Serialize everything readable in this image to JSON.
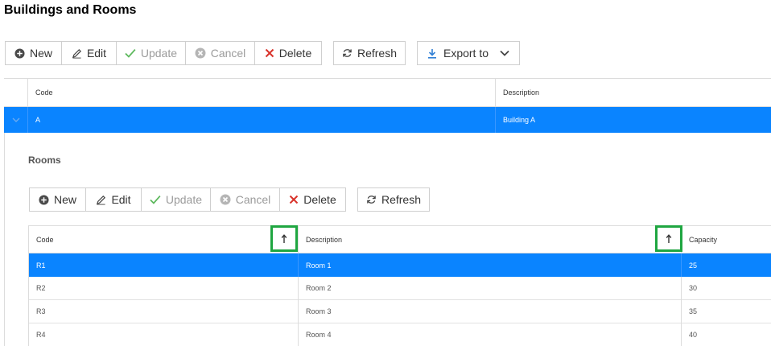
{
  "page": {
    "title": "Buildings and Rooms"
  },
  "buildings_toolbar": {
    "new": "New",
    "edit": "Edit",
    "update": "Update",
    "cancel": "Cancel",
    "delete": "Delete",
    "refresh": "Refresh",
    "export": "Export to"
  },
  "buildings_grid": {
    "columns": [
      "Code",
      "Description"
    ],
    "rows": [
      {
        "code": "A",
        "description": "Building A",
        "selected": true
      }
    ]
  },
  "rooms": {
    "title": "Rooms",
    "toolbar": {
      "new": "New",
      "edit": "Edit",
      "update": "Update",
      "cancel": "Cancel",
      "delete": "Delete",
      "refresh": "Refresh"
    },
    "columns": [
      "Code",
      "Description",
      "Capacity"
    ],
    "rows": [
      {
        "code": "R1",
        "description": "Room 1",
        "capacity": "25"
      },
      {
        "code": "R2",
        "description": "Room 2",
        "capacity": "30"
      },
      {
        "code": "R3",
        "description": "Room 3",
        "capacity": "35"
      },
      {
        "code": "R4",
        "description": "Room 4",
        "capacity": "40"
      }
    ]
  },
  "colors": {
    "selection": "#0a84ff",
    "highlight_border": "#1fa641",
    "delete_icon": "#d9332b",
    "check_icon": "#5cb85c",
    "export_icon": "#2f7fd4"
  },
  "icons": {
    "new": "plus-circle-icon",
    "edit": "pencil-icon",
    "update": "check-icon",
    "cancel": "x-circle-icon",
    "delete": "x-icon",
    "refresh": "refresh-icon",
    "export": "download-icon",
    "export_dropdown": "chevron-down-icon",
    "expand": "chevron-down-icon",
    "sort": "arrow-up-icon"
  }
}
